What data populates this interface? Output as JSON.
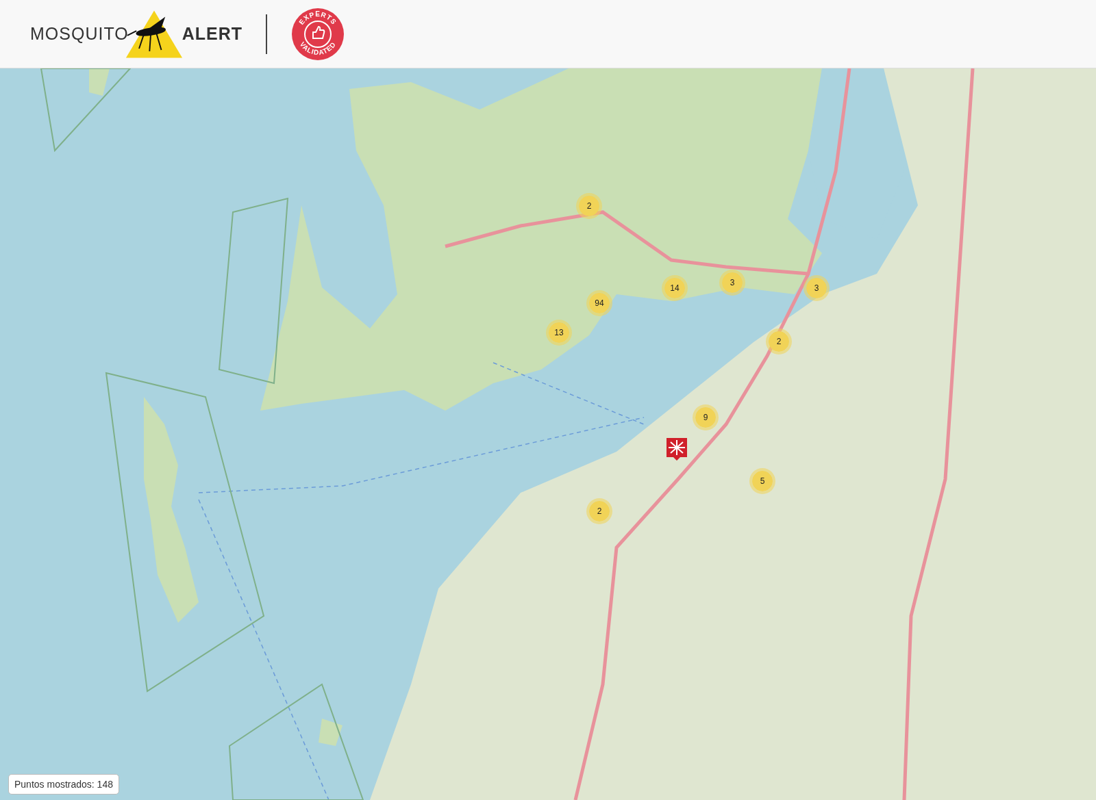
{
  "header": {
    "logo": {
      "word_1": "MOSQUITO",
      "word_2": "ALERT"
    },
    "badge": {
      "top_text": "EXPERTS",
      "bottom_text": "VALIDATED"
    }
  },
  "map": {
    "markers": [
      {
        "kind": "cluster",
        "count": "2"
      },
      {
        "kind": "cluster",
        "count": "14"
      },
      {
        "kind": "cluster",
        "count": "3"
      },
      {
        "kind": "cluster",
        "count": "3"
      },
      {
        "kind": "cluster",
        "count": "94"
      },
      {
        "kind": "cluster",
        "count": "13"
      },
      {
        "kind": "cluster",
        "count": "2"
      },
      {
        "kind": "cluster",
        "count": "9"
      },
      {
        "kind": "cluster",
        "count": "5"
      },
      {
        "kind": "cluster",
        "count": "2"
      },
      {
        "kind": "validated"
      }
    ],
    "points_counter": "Puntos mostrados: 148"
  }
}
